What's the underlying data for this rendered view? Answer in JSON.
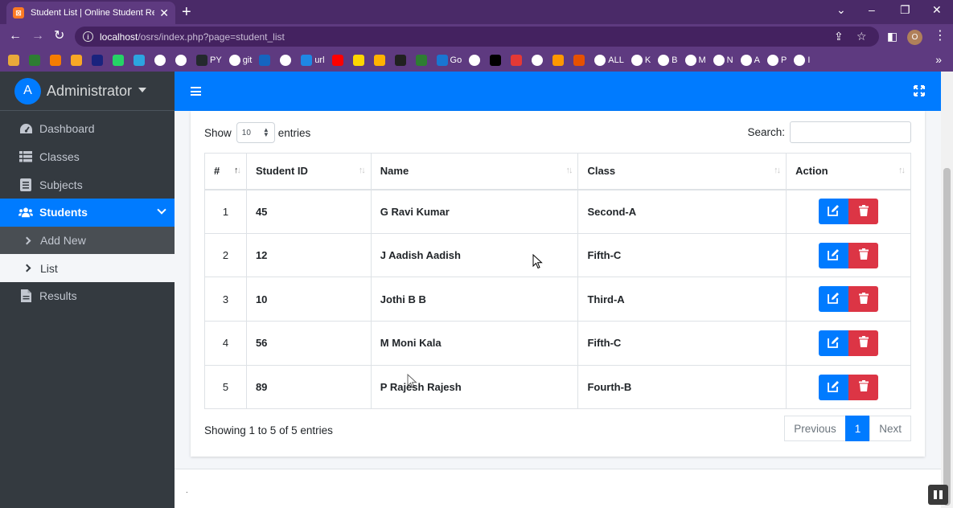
{
  "browser": {
    "tab_title": "Student List | Online Student Res",
    "tab_favicon": "XAMPP",
    "url_host": "localhost",
    "url_path": "/osrs/index.php?page=student_list",
    "profile_initial": "O",
    "bookmarks": [
      {
        "label": "",
        "color": "#e8a93a"
      },
      {
        "label": "",
        "color": "#2e7d32"
      },
      {
        "label": "",
        "color": "#f57c00"
      },
      {
        "label": "",
        "color": "#f9a825"
      },
      {
        "label": "",
        "color": "#1a237e"
      },
      {
        "label": "",
        "color": "#25d366"
      },
      {
        "label": "",
        "color": "#2ca5e0"
      },
      {
        "label": "",
        "color": "#ffffff"
      },
      {
        "label": "",
        "color": "#ffffff"
      },
      {
        "label": "PY",
        "color": "#24292e"
      },
      {
        "label": "git",
        "color": "#ffffff"
      },
      {
        "label": "",
        "color": "#1565c0"
      },
      {
        "label": "",
        "color": "#ffffff"
      },
      {
        "label": "url",
        "color": "#1e88e5"
      },
      {
        "label": "",
        "color": "#ff0000"
      },
      {
        "label": "",
        "color": "#ffd600"
      },
      {
        "label": "",
        "color": "#ffb300"
      },
      {
        "label": "",
        "color": "#212121"
      },
      {
        "label": "",
        "color": "#2e7d32"
      },
      {
        "label": "Go",
        "color": "#1976d2"
      },
      {
        "label": "",
        "color": "#ffffff"
      },
      {
        "label": "",
        "color": "#000000"
      },
      {
        "label": "",
        "color": "#e53935"
      },
      {
        "label": "",
        "color": "#ffffff"
      },
      {
        "label": "",
        "color": "#ff9800"
      },
      {
        "label": "",
        "color": "#e65100"
      },
      {
        "label": "ALL",
        "color": "#ffffff"
      },
      {
        "label": "K",
        "color": "#ffffff"
      },
      {
        "label": "B",
        "color": "#ffffff"
      },
      {
        "label": "M",
        "color": "#ffffff"
      },
      {
        "label": "N",
        "color": "#ffffff"
      },
      {
        "label": "A",
        "color": "#ffffff"
      },
      {
        "label": "P",
        "color": "#ffffff"
      },
      {
        "label": "I",
        "color": "#ffffff"
      }
    ]
  },
  "sidebar": {
    "avatar_initial": "A",
    "user_name": "Administrator",
    "items": [
      {
        "label": "Dashboard",
        "icon": "dashboard-icon"
      },
      {
        "label": "Classes",
        "icon": "list-icon"
      },
      {
        "label": "Subjects",
        "icon": "book-icon"
      },
      {
        "label": "Students",
        "icon": "users-icon"
      },
      {
        "label": "Results",
        "icon": "file-icon"
      }
    ],
    "sub_items": [
      {
        "label": "Add New"
      },
      {
        "label": "List"
      }
    ]
  },
  "table_controls": {
    "show_label": "Show",
    "entries_value": "10",
    "entries_label": "entries",
    "search_label": "Search:"
  },
  "table": {
    "headers": [
      "#",
      "Student ID",
      "Name",
      "Class",
      "Action"
    ],
    "rows": [
      {
        "num": "1",
        "student_id": "45",
        "name": "G Ravi Kumar",
        "class": "Second-A"
      },
      {
        "num": "2",
        "student_id": "12",
        "name": "J Aadish Aadish",
        "class": "Fifth-C"
      },
      {
        "num": "3",
        "student_id": "10",
        "name": "Jothi B B",
        "class": "Third-A"
      },
      {
        "num": "4",
        "student_id": "56",
        "name": "M Moni Kala",
        "class": "Fifth-C"
      },
      {
        "num": "5",
        "student_id": "89",
        "name": "P Rajesh Rajesh",
        "class": "Fourth-B"
      }
    ]
  },
  "pagination": {
    "info": "Showing 1 to 5 of 5 entries",
    "previous": "Previous",
    "current": "1",
    "next": "Next"
  },
  "footer": {
    "dot": "."
  },
  "colors": {
    "primary": "#007bff",
    "danger": "#dc3545",
    "sidebar_bg": "#343a40",
    "browser_frame": "#5e3a80"
  }
}
